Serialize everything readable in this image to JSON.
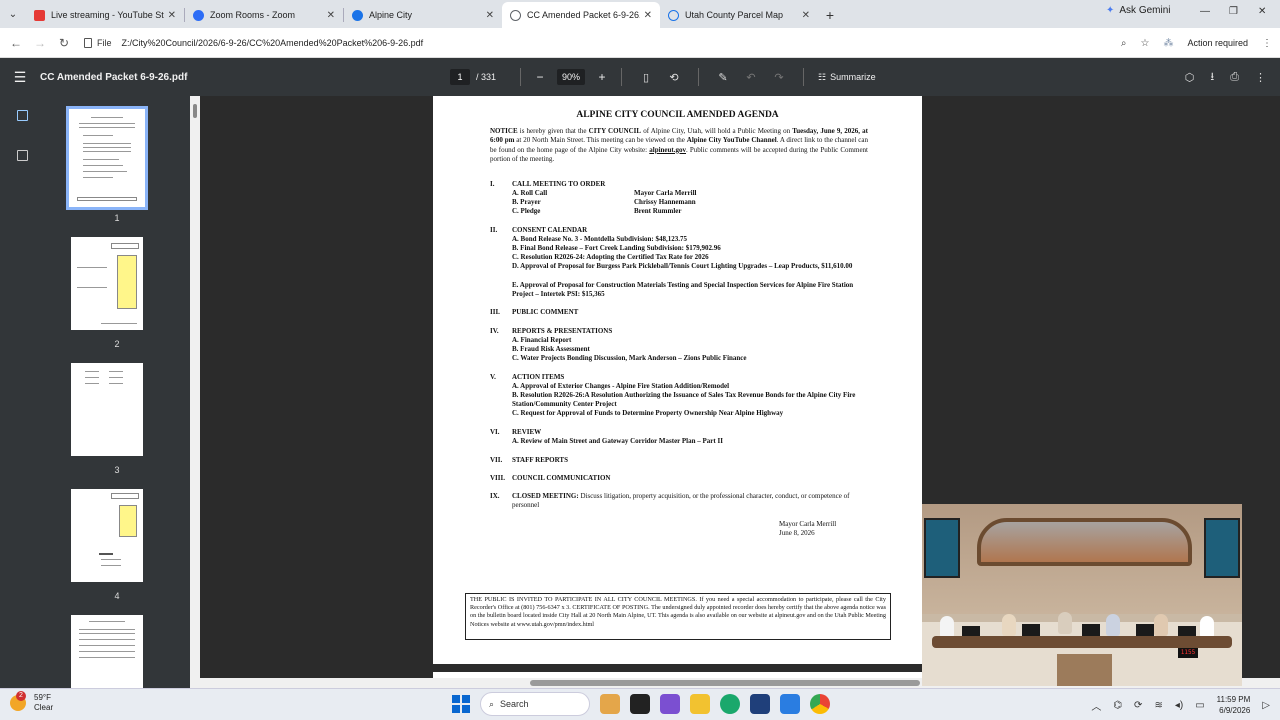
{
  "tabs": [
    {
      "label": "Live streaming - YouTube Studi",
      "color": "#e53935"
    },
    {
      "label": "Zoom Rooms - Zoom",
      "color": "#2d6df6"
    },
    {
      "label": "Alpine City",
      "color": "#1a73e8"
    },
    {
      "label": "CC Amended Packet 6-9-26.pdf",
      "color": "#5f6368"
    },
    {
      "label": "Utah County Parcel Map",
      "color": "#1a73e8"
    }
  ],
  "browser": {
    "ask_gemini": "Ask Gemini",
    "file_chip": "File",
    "url": "Z:/City%20Council/2026/6-9-26/CC%20Amended%20Packet%206-9-26.pdf",
    "action_required": "Action required"
  },
  "pdf": {
    "title": "CC Amended Packet 6-9-26.pdf",
    "page": "1",
    "total": "/ 331",
    "zoom": "90%",
    "summarize": "Summarize"
  },
  "thumbnails": [
    "1",
    "2",
    "3",
    "4"
  ],
  "agenda": {
    "title": "ALPINE CITY COUNCIL AMENDED AGENDA",
    "notice_1": "NOTICE",
    "notice_2": " is hereby given that the ",
    "notice_3": "CITY COUNCIL",
    "notice_4": " of Alpine City, Utah, will hold a Public Meeting on ",
    "notice_5": "Tuesday, June 9, 2026, at 6:00 pm",
    "notice_6": " at 20 North Main Street. This meeting can be viewed on the ",
    "notice_7": "Alpine City YouTube Channel",
    "notice_8": ". A direct link to the channel can be found on the home page of the Alpine City website: ",
    "notice_9": "alpineut.gov",
    "notice_10": ". Public comments will be accepted during the Public Comment portion of the meeting.",
    "s1": {
      "num": "I.",
      "title": "CALL MEETING TO ORDER"
    },
    "s1a": {
      "item": "A.   Roll Call",
      "who": "Mayor Carla Merrill"
    },
    "s1b": {
      "item": "B.   Prayer",
      "who": "Chrissy Hannemann"
    },
    "s1c": {
      "item": "C.   Pledge",
      "who": "Brent Rummler"
    },
    "s2": {
      "num": "II.",
      "title": "CONSENT CALENDAR"
    },
    "s2a": "A.   Bond Release No. 3 - Montdella Subdivision: $48,123.75",
    "s2b": "B.   Final Bond Release – Fort Creek Landing Subdivision: $179,902.96",
    "s2c": "C.   Resolution R2026-24: Adopting the Certified Tax Rate for 2026",
    "s2d": "D.   Approval of Proposal for Burgess Park Pickleball/Tennis Court Lighting Upgrades – Leap Products, $11,610.00",
    "s2e": "E.   Approval of Proposal for Construction Materials Testing and Special Inspection Services for Alpine Fire Station Project – Intertek PSI: $15,365",
    "s3": {
      "num": "III.",
      "title": "PUBLIC COMMENT"
    },
    "s4": {
      "num": "IV.",
      "title": "REPORTS & PRESENTATIONS"
    },
    "s4a": "A.   Financial Report",
    "s4b": "B.   Fraud Risk Assessment",
    "s4c": "C.   Water Projects Bonding Discussion, Mark Anderson – Zions Public Finance",
    "s5": {
      "num": "V.",
      "title": "ACTION ITEMS"
    },
    "s5a": "A.   Approval of Exterior Changes - Alpine Fire Station Addition/Remodel",
    "s5b": "B.   Resolution R2026-26:A Resolution Authorizing the Issuance of Sales Tax Revenue Bonds for the Alpine City Fire Station/Community Center Project",
    "s5c": "C.   Request for Approval of Funds to Determine Property Ownership Near Alpine Highway",
    "s6": {
      "num": "VI.",
      "title": "REVIEW"
    },
    "s6a": "A.   Review of Main Street and Gateway Corridor Master Plan – Part II",
    "s7": {
      "num": "VII.",
      "title": "STAFF REPORTS"
    },
    "s8": {
      "num": "VIII.",
      "title": "COUNCIL COMMUNICATION"
    },
    "s9": {
      "num": "IX.",
      "title": "CLOSED MEETING:",
      "rest": " Discuss litigation, property acquisition, or the professional character, conduct, or competence of personnel"
    },
    "sign_name": "Mayor Carla Merrill",
    "sign_date": "June 8, 2026",
    "box": "THE PUBLIC IS INVITED TO PARTICIPATE IN ALL CITY COUNCIL MEETINGS. If you need a special accommodation to participate, please call the City Recorder's Office at (801) 756-6347 x 3. CERTIFICATE OF POSTING. The undersigned duly appointed recorder does hereby certify that the above agenda notice was on the bulletin board located inside City Hall at 20 North Main Alpine, UT. This agenda is also available on our website at alpineut.gov and on the Utah Public Meeting Notices website at www.utah.gov/pmn/index.html"
  },
  "webcam": {
    "led": "1155"
  },
  "taskbar": {
    "temp": "59°F",
    "cond": "Clear",
    "badge": "2",
    "search": "Search",
    "time": "11:59 PM",
    "date": "6/9/2026"
  }
}
